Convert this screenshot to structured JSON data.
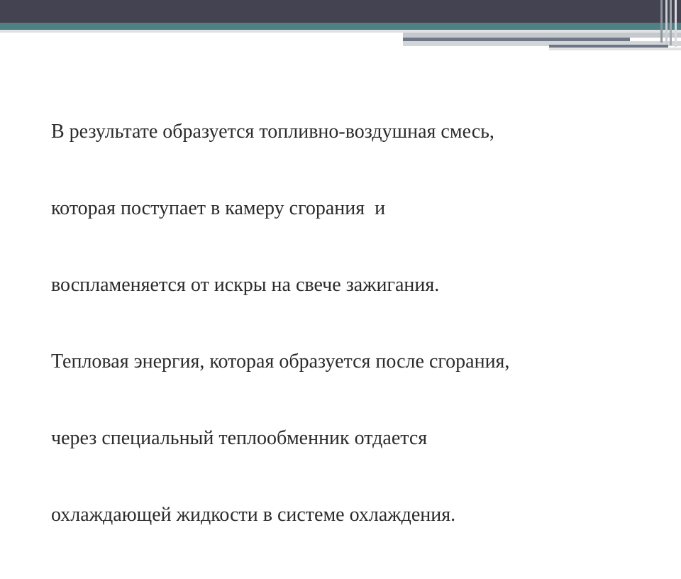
{
  "slide": {
    "body_lines": [
      "В результате образуется топливно-воздушная смесь,",
      "которая поступает в камеру сгорания  и",
      "воспламеняется от искры на свече зажигания.",
      "Тепловая энергия, которая образуется после сгорания,",
      "через специальный теплообменник отдается",
      "охлаждающей жидкости в системе охлаждения."
    ]
  },
  "colors": {
    "header_dark": "#434351",
    "header_teal": "#4f8184",
    "accent_blue": "#6f7686",
    "text": "#2b2b2b",
    "background": "#ffffff"
  }
}
